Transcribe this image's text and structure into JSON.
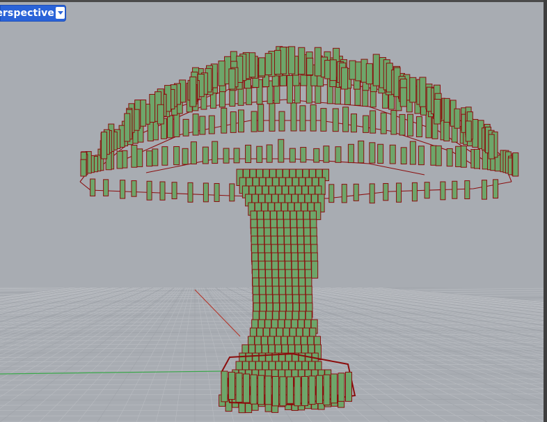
{
  "viewport": {
    "title": "Perspective",
    "title_visible": "erspective",
    "dropdown_icon": "chevron-down-icon"
  },
  "colors": {
    "background": "#a8acb2",
    "grid_minor": "#b9bcc1",
    "grid_major": "#9ea2a8",
    "x_axis": "#b33a2f",
    "y_axis": "#3aa84a",
    "block_fill": "#6ea66a",
    "block_edge": "#8b0d0d",
    "tab_blue": "#2a63d8"
  }
}
